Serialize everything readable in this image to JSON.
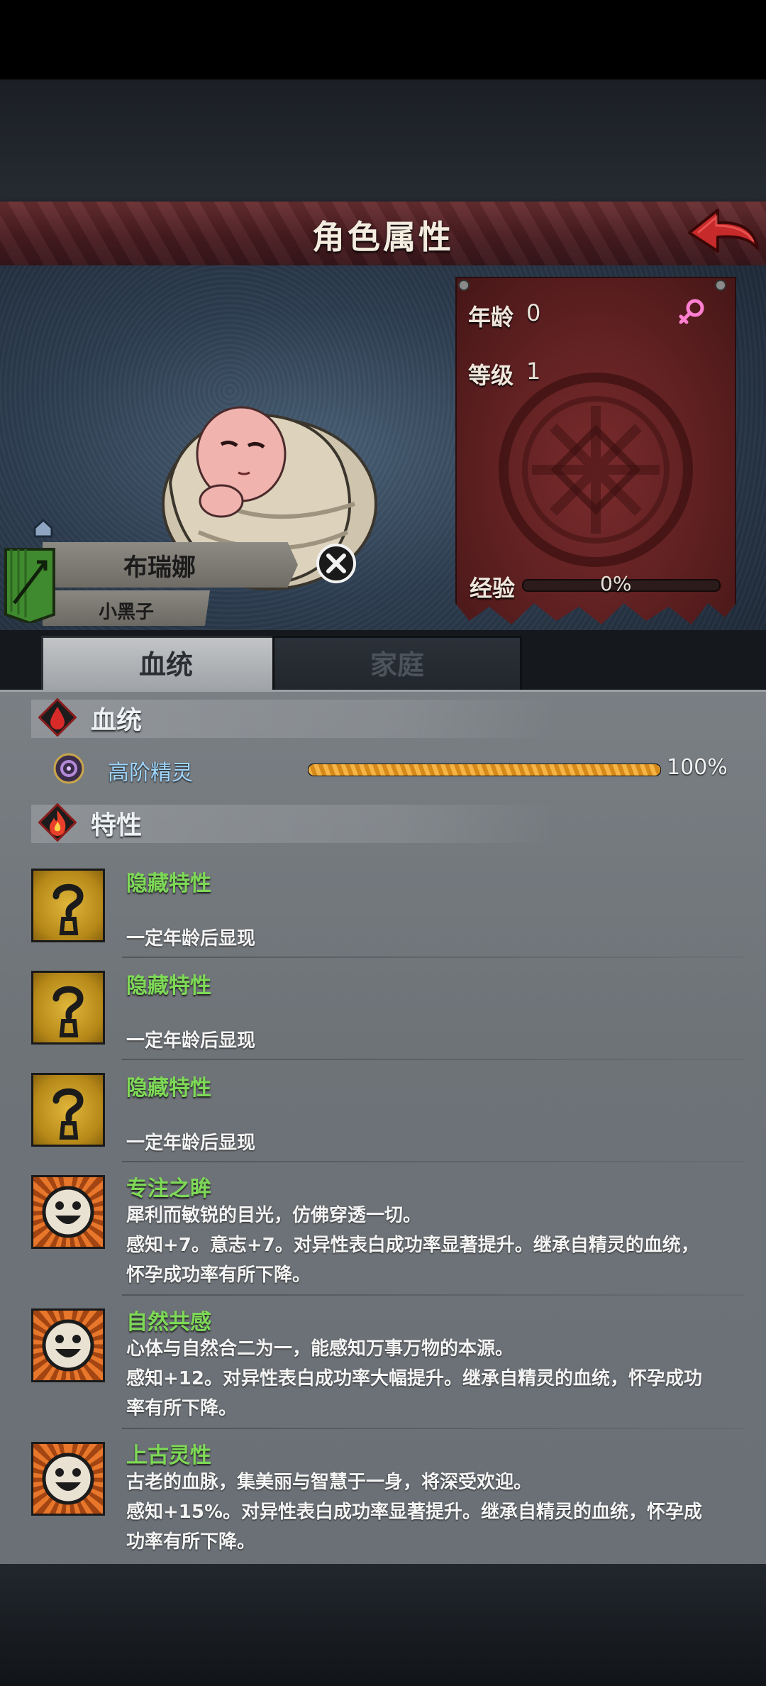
{
  "header": {
    "title": "角色属性"
  },
  "character": {
    "name": "布瑞娜",
    "nickname": "小黑子",
    "age_label": "年龄",
    "age_value": "0",
    "level_label": "等级",
    "level_value": "1",
    "exp_label": "经验",
    "exp_value": "0%",
    "exp_fraction": 0.0,
    "gender_icon": "female-icon"
  },
  "tabs": [
    {
      "label": "血统",
      "active": true
    },
    {
      "label": "家庭",
      "active": false
    }
  ],
  "bloodline": {
    "section_title": "血统",
    "items": [
      {
        "name": "高阶精灵",
        "percent_text": "100%",
        "fraction": 1.0
      }
    ]
  },
  "traits": {
    "section_title": "特性",
    "items": [
      {
        "name": "隐藏特性",
        "lines": [
          "",
          "一定年龄后显现"
        ],
        "icon": "question-icon"
      },
      {
        "name": "隐藏特性",
        "lines": [
          "",
          "一定年龄后显现"
        ],
        "icon": "question-icon"
      },
      {
        "name": "隐藏特性",
        "lines": [
          "",
          "一定年龄后显现"
        ],
        "icon": "question-icon"
      },
      {
        "name": "专注之眸",
        "lines": [
          "犀利而敏锐的目光，仿佛穿透一切。",
          "感知+7。意志+7。对异性表白成功率显著提升。继承自精灵的血统，",
          "怀孕成功率有所下降。"
        ],
        "icon": "smiley-icon"
      },
      {
        "name": "自然共感",
        "lines": [
          "心体与自然合二为一，能感知万事万物的本源。",
          "感知+12。对异性表白成功率大幅提升。继承自精灵的血统，怀孕成功",
          "率有所下降。"
        ],
        "icon": "smiley-icon"
      },
      {
        "name": "上古灵性",
        "lines": [
          "古老的血脉，集美丽与智慧于一身，将深受欢迎。",
          "感知+15%。对异性表白成功率显著提升。继承自精灵的血统，怀孕成",
          "功率有所下降。"
        ],
        "icon": "smiley-icon"
      }
    ]
  },
  "colors": {
    "title_bar": "#4a1d21",
    "trait_name": "#7ed957",
    "bloodline_name": "#9fd6ff",
    "bloodline_bar": "#f5b445"
  }
}
